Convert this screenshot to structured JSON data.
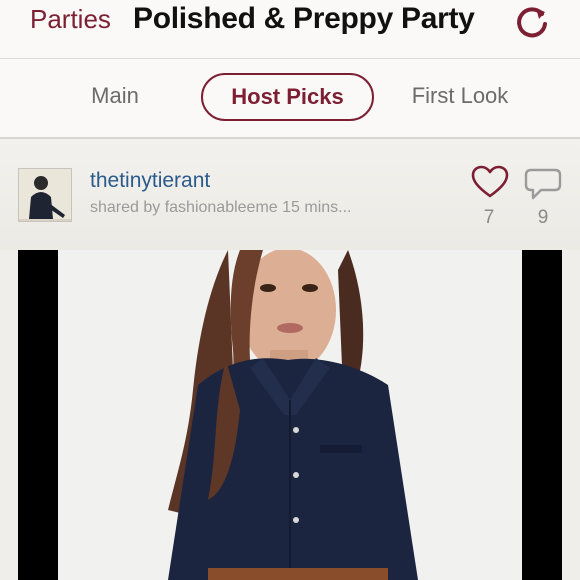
{
  "header": {
    "back_label": "Parties",
    "title": "Polished & Preppy Party",
    "refresh_icon": "refresh-icon"
  },
  "tabs": [
    {
      "label": "Main",
      "active": false
    },
    {
      "label": "Host Picks",
      "active": true
    },
    {
      "label": "First Look",
      "active": false
    }
  ],
  "post": {
    "username": "thetinytierant",
    "shared_by": "shared by fashionableeme 15 mins...",
    "likes": "7",
    "comments": "9"
  },
  "colors": {
    "accent": "#7d1f33",
    "link": "#2a5b8c",
    "muted": "#9a9a9a"
  }
}
